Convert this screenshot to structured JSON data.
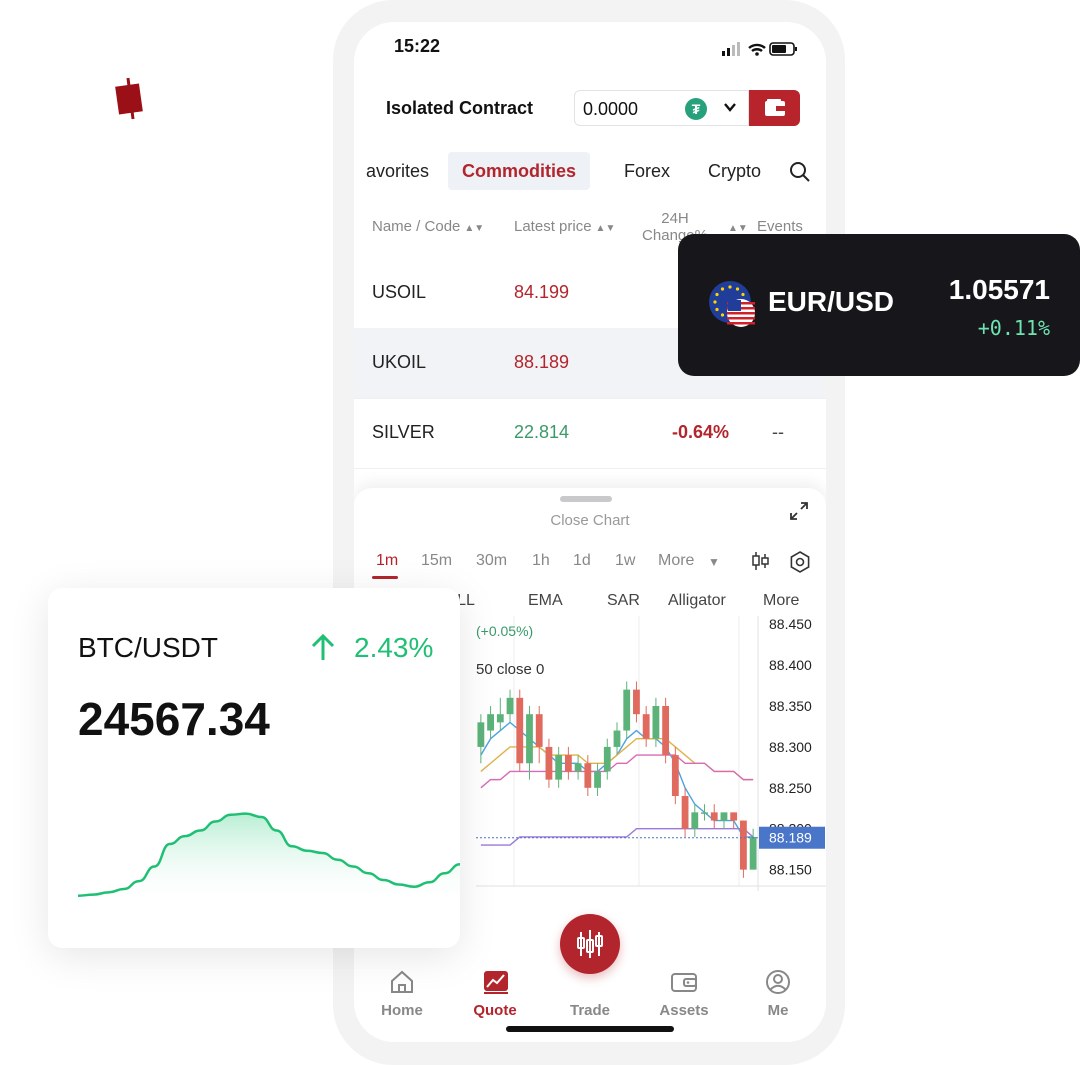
{
  "status": {
    "time": "15:22"
  },
  "contract": {
    "title": "Isolated Contract",
    "value": "0.0000",
    "coin_symbol": "₮"
  },
  "tabs": [
    {
      "label": "avorites",
      "active": false
    },
    {
      "label": "Commodities",
      "active": true
    },
    {
      "label": "Forex",
      "active": false
    },
    {
      "label": "Crypto",
      "active": false
    }
  ],
  "columns": {
    "name": "Name / Code",
    "price": "Latest price",
    "change": "24H Change%",
    "events": "Events"
  },
  "rows": [
    {
      "name": "USOIL",
      "price": "84.199",
      "change": "",
      "events": "",
      "trend": "down"
    },
    {
      "name": "UKOIL",
      "price": "88.189",
      "change": "",
      "events": "",
      "trend": "down"
    },
    {
      "name": "SILVER",
      "price": "22.814",
      "change": "-0.64%",
      "events": "--",
      "trend": "up"
    }
  ],
  "chart_panel": {
    "close_label": "Close Chart",
    "timeframes": [
      "1m",
      "15m",
      "30m",
      "1h",
      "1d",
      "1w",
      "More"
    ],
    "active_timeframe": "1m",
    "indicators": [
      "BOLL",
      "EMA",
      "SAR",
      "Alligator",
      "More"
    ],
    "overlay_change": "(+0.05%)",
    "overlay_label": "50 close 0"
  },
  "chart_data": {
    "type": "line",
    "title": "",
    "y_ticks": [
      "88.450",
      "88.400",
      "88.350",
      "88.300",
      "88.250",
      "88.200",
      "88.150"
    ],
    "ylim": [
      88.13,
      88.46
    ],
    "current_price": "88.189",
    "candles": [
      [
        88.3,
        88.33,
        88.28,
        88.34
      ],
      [
        88.32,
        88.34,
        88.31,
        88.35
      ],
      [
        88.33,
        88.34,
        88.32,
        88.36
      ],
      [
        88.34,
        88.36,
        88.33,
        88.37
      ],
      [
        88.36,
        88.28,
        88.27,
        88.37
      ],
      [
        88.28,
        88.34,
        88.26,
        88.35
      ],
      [
        88.34,
        88.3,
        88.28,
        88.35
      ],
      [
        88.3,
        88.26,
        88.25,
        88.31
      ],
      [
        88.26,
        88.29,
        88.25,
        88.3
      ],
      [
        88.29,
        88.27,
        88.26,
        88.3
      ],
      [
        88.27,
        88.28,
        88.26,
        88.29
      ],
      [
        88.28,
        88.25,
        88.24,
        88.29
      ],
      [
        88.25,
        88.27,
        88.24,
        88.28
      ],
      [
        88.27,
        88.3,
        88.26,
        88.31
      ],
      [
        88.3,
        88.32,
        88.29,
        88.33
      ],
      [
        88.32,
        88.37,
        88.31,
        88.38
      ],
      [
        88.37,
        88.34,
        88.33,
        88.38
      ],
      [
        88.34,
        88.31,
        88.3,
        88.35
      ],
      [
        88.31,
        88.35,
        88.3,
        88.36
      ],
      [
        88.35,
        88.29,
        88.28,
        88.36
      ],
      [
        88.29,
        88.24,
        88.23,
        88.3
      ],
      [
        88.24,
        88.2,
        88.19,
        88.25
      ],
      [
        88.2,
        88.22,
        88.19,
        88.23
      ],
      [
        88.22,
        88.22,
        88.21,
        88.23
      ],
      [
        88.22,
        88.21,
        88.2,
        88.23
      ],
      [
        88.21,
        88.22,
        88.2,
        88.22
      ],
      [
        88.22,
        88.21,
        88.2,
        88.22
      ],
      [
        88.21,
        88.15,
        88.14,
        88.21
      ],
      [
        88.15,
        88.19,
        88.15,
        88.2
      ]
    ],
    "series": [
      {
        "color": "#4aa3df",
        "values": [
          88.29,
          88.31,
          88.32,
          88.33,
          88.32,
          88.31,
          88.3,
          88.29,
          88.28,
          88.28,
          88.28,
          88.27,
          88.27,
          88.28,
          88.29,
          88.31,
          88.32,
          88.31,
          88.31,
          88.3,
          88.28,
          88.25,
          88.23,
          88.22,
          88.21,
          88.21,
          88.21,
          88.19,
          88.19
        ]
      },
      {
        "color": "#e0b24a",
        "values": [
          88.27,
          88.28,
          88.29,
          88.3,
          88.3,
          88.3,
          88.3,
          88.29,
          88.29,
          88.29,
          88.29,
          88.28,
          88.28,
          88.28,
          88.29,
          88.3,
          88.31,
          88.31,
          88.31,
          88.31,
          88.3,
          88.29,
          88.28,
          88.28,
          88.27,
          88.27,
          88.27,
          88.26,
          88.26
        ]
      },
      {
        "color": "#d86bb5",
        "values": [
          88.25,
          88.26,
          88.26,
          88.27,
          88.27,
          88.27,
          88.27,
          88.27,
          88.27,
          88.27,
          88.27,
          88.27,
          88.27,
          88.27,
          88.28,
          88.28,
          88.29,
          88.29,
          88.29,
          88.29,
          88.29,
          88.28,
          88.28,
          88.28,
          88.27,
          88.27,
          88.27,
          88.26,
          88.26
        ]
      },
      {
        "color": "#9b79d8",
        "values": [
          88.18,
          88.18,
          88.18,
          88.18,
          88.19,
          88.19,
          88.19,
          88.19,
          88.19,
          88.19,
          88.19,
          88.19,
          88.19,
          88.19,
          88.19,
          88.19,
          88.2,
          88.2,
          88.2,
          88.2,
          88.2,
          88.2,
          88.2,
          88.2,
          88.2,
          88.2,
          88.2,
          88.2,
          88.19
        ]
      }
    ]
  },
  "nav": [
    {
      "label": "Home",
      "active": false,
      "icon": "home-icon"
    },
    {
      "label": "Quote",
      "active": true,
      "icon": "chart-icon"
    },
    {
      "label": "Trade",
      "active": false,
      "icon": "candlestick-icon"
    },
    {
      "label": "Assets",
      "active": false,
      "icon": "wallet-icon"
    },
    {
      "label": "Me",
      "active": false,
      "icon": "profile-icon"
    }
  ],
  "eur_card": {
    "pair": "EUR/USD",
    "price": "1.05571",
    "change": "+0.11%"
  },
  "btc_card": {
    "pair": "BTC/USDT",
    "change": "2.43%",
    "price": "24567.34",
    "sparkline": [
      2,
      3,
      5,
      8,
      15,
      28,
      48,
      55,
      60,
      68,
      74,
      75,
      72,
      60,
      46,
      42,
      40,
      34,
      28,
      22,
      16,
      12,
      10,
      14,
      22,
      30
    ]
  },
  "colors": {
    "accent": "#b3252c",
    "green": "#1fbf74",
    "text": "#111111"
  }
}
